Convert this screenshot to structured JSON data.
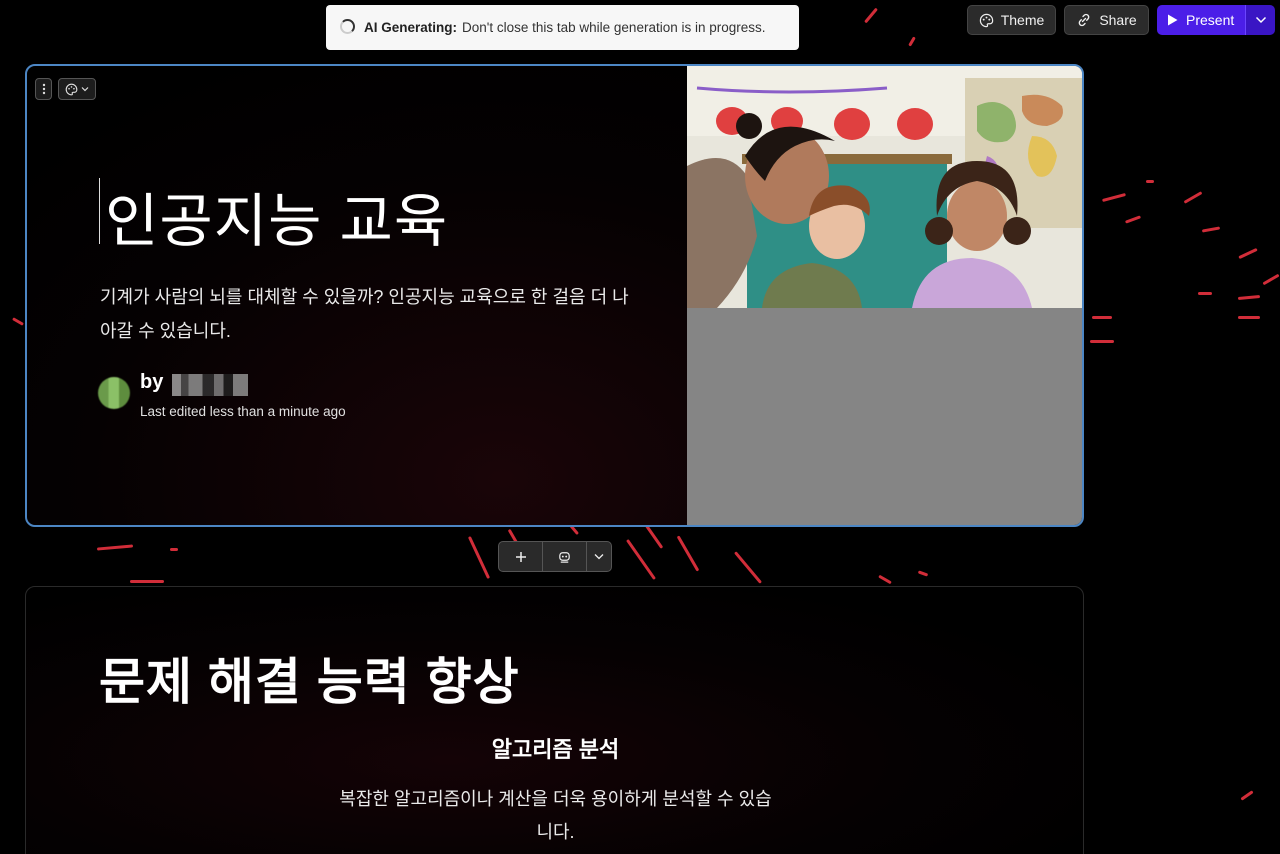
{
  "toast": {
    "label": "AI Generating:",
    "message": "Don't close this tab while generation is in progress."
  },
  "toolbar": {
    "theme_label": "Theme",
    "share_label": "Share",
    "present_label": "Present"
  },
  "card1": {
    "title": "인공지능 교육",
    "description": "기계가 사람의 뇌를 대체할 수 있을까? 인공지능 교육으로 한 걸음 더 나아갈 수 있습니다.",
    "author_prefix": "by",
    "edited": "Last edited less than a minute ago"
  },
  "card2": {
    "title": "문제 해결 능력 향상",
    "subtitle": "알고리즘 분석",
    "description": "복잡한 알고리즘이나 계산을 더욱 용이하게 분석할 수 있습니다."
  },
  "colors": {
    "accent": "#4b1ee8",
    "card_border": "#4c86c4",
    "streak": "#e8323f"
  }
}
